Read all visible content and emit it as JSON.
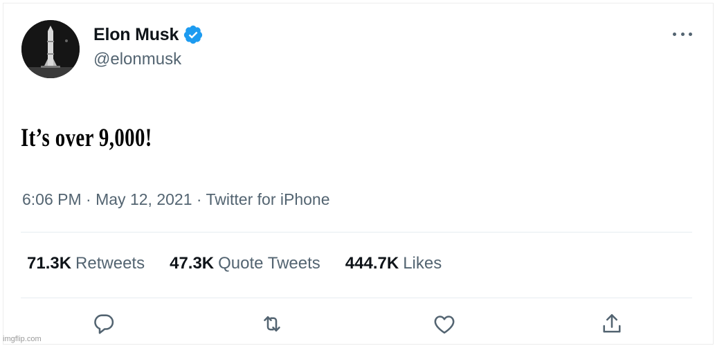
{
  "author": {
    "name": "Elon Musk",
    "handle": "@elonmusk",
    "verified": true,
    "avatar_icon": "rocket-avatar"
  },
  "tweet": {
    "text": "It’s over 9,000!",
    "time": "6:06 PM",
    "date": "May 12, 2021",
    "source": "Twitter for iPhone",
    "separator": "·"
  },
  "stats": [
    {
      "count": "71.3K",
      "label": "Retweets"
    },
    {
      "count": "47.3K",
      "label": "Quote Tweets"
    },
    {
      "count": "444.7K",
      "label": "Likes"
    }
  ],
  "actions": [
    "reply-icon",
    "retweet-icon",
    "like-icon",
    "share-icon"
  ],
  "watermark": "imgflip.com",
  "colors": {
    "text_primary": "#0f1419",
    "text_secondary": "#536471",
    "verified_blue": "#1d9bf0",
    "divider": "#e6ecf0"
  }
}
